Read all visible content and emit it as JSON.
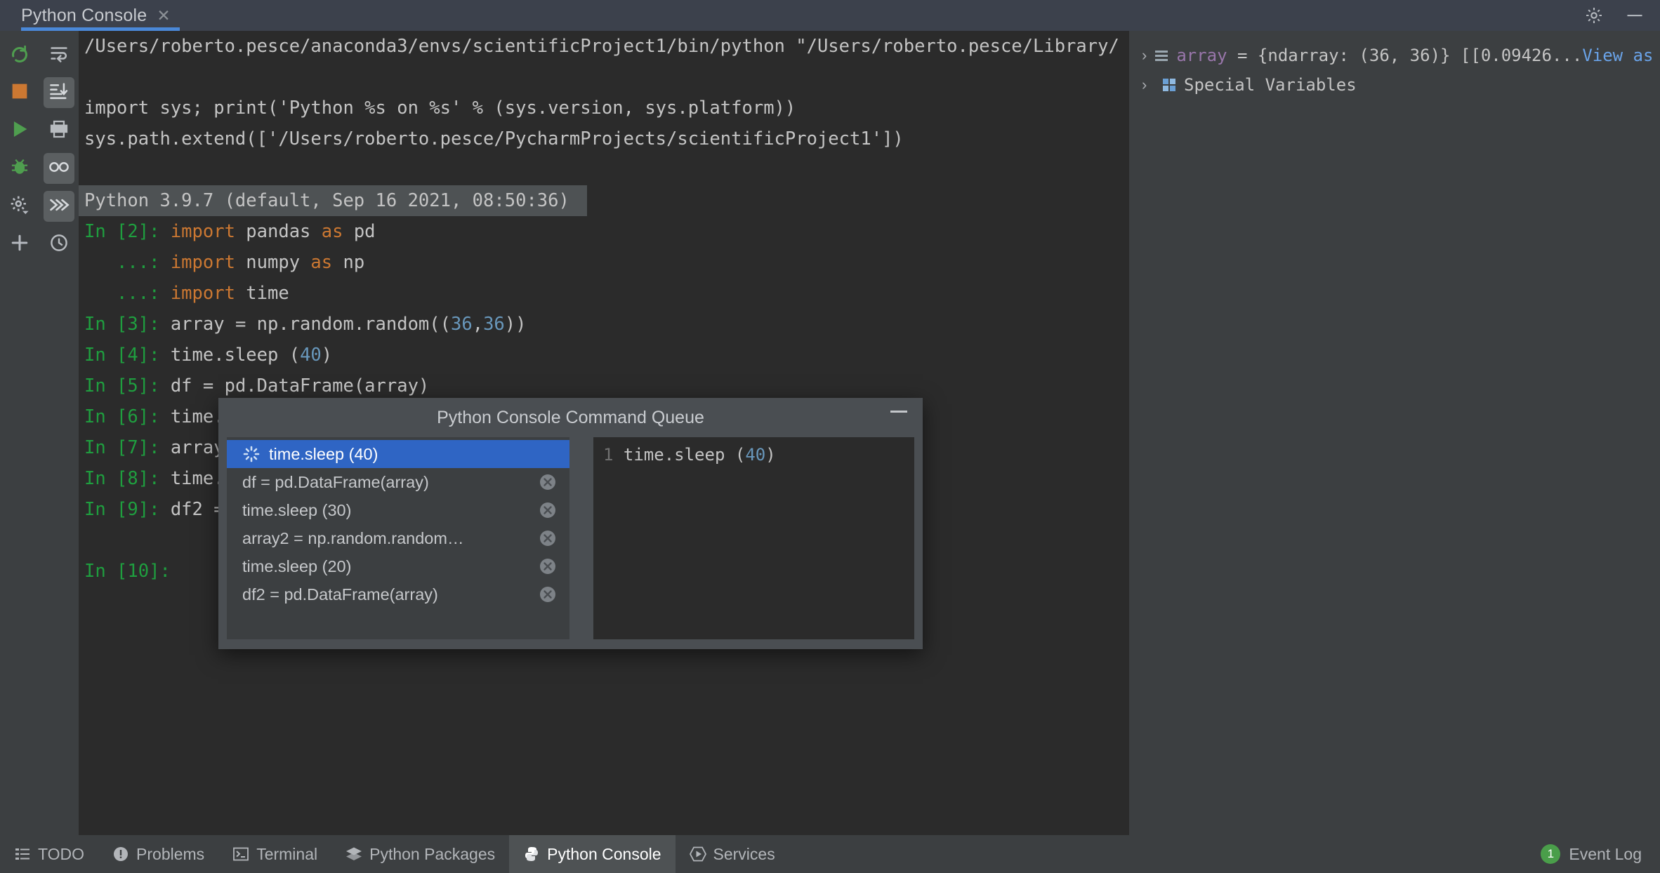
{
  "window": {
    "tab_label": "Python Console",
    "tab_close_icon": "close-icon",
    "settings_icon": "gear-icon",
    "minimize_icon": "minimize-icon"
  },
  "left_toolbar_primary": [
    {
      "name": "rerun-console-button",
      "icon": "rerun-icon"
    },
    {
      "name": "stop-button",
      "icon": "stop-square-icon"
    },
    {
      "name": "execute-button",
      "icon": "play-triangle-icon"
    },
    {
      "name": "debug-button",
      "icon": "bug-icon"
    },
    {
      "name": "settings-button",
      "icon": "gear-dropdown-icon"
    },
    {
      "name": "add-console-button",
      "icon": "plus-icon"
    }
  ],
  "left_toolbar_secondary": [
    {
      "name": "soft-wrap-button",
      "icon": "soft-wrap-icon",
      "active": false
    },
    {
      "name": "scroll-to-end-button",
      "icon": "scroll-to-end-icon",
      "active": true
    },
    {
      "name": "print-button",
      "icon": "printer-icon",
      "active": false
    },
    {
      "name": "show-variables-button",
      "icon": "glasses-icon",
      "active": true
    },
    {
      "name": "execute-multiline-button",
      "icon": "chevrons-right-icon",
      "active": true
    },
    {
      "name": "command-history-button",
      "icon": "clock-icon",
      "active": false
    }
  ],
  "console": {
    "lines": [
      {
        "type": "plain",
        "segments": [
          {
            "text": "/Users/roberto.pesce/anaconda3/envs/scientificProject1/bin/python \"/Users/roberto.pesce/Library/",
            "cls": "plain"
          }
        ]
      },
      {
        "type": "blank",
        "segments": []
      },
      {
        "type": "plain",
        "segments": [
          {
            "text": "import sys; print('Python %s on %s' % (sys.version, sys.platform))",
            "cls": "plain"
          }
        ]
      },
      {
        "type": "plain",
        "segments": [
          {
            "text": "sys.path.extend(['/Users/roberto.pesce/PycharmProjects/scientificProject1'])",
            "cls": "plain"
          }
        ]
      },
      {
        "type": "blank",
        "segments": []
      },
      {
        "type": "banner",
        "segments": [
          {
            "text": "Python 3.9.7 (default, Sep 16 2021, 08:50:36) ",
            "cls": "plain"
          }
        ]
      },
      {
        "type": "plain",
        "segments": [
          {
            "text": "In [2]: ",
            "cls": "prompt"
          },
          {
            "text": "import ",
            "cls": "kw"
          },
          {
            "text": "pandas ",
            "cls": "plain"
          },
          {
            "text": "as ",
            "cls": "kw"
          },
          {
            "text": "pd",
            "cls": "plain"
          }
        ]
      },
      {
        "type": "plain",
        "segments": [
          {
            "text": "   ...: ",
            "cls": "prompt"
          },
          {
            "text": "import ",
            "cls": "kw"
          },
          {
            "text": "numpy ",
            "cls": "plain"
          },
          {
            "text": "as ",
            "cls": "kw"
          },
          {
            "text": "np",
            "cls": "plain"
          }
        ]
      },
      {
        "type": "plain",
        "segments": [
          {
            "text": "   ...: ",
            "cls": "prompt"
          },
          {
            "text": "import ",
            "cls": "kw"
          },
          {
            "text": "time",
            "cls": "plain"
          }
        ]
      },
      {
        "type": "plain",
        "segments": [
          {
            "text": "In [3]: ",
            "cls": "prompt"
          },
          {
            "text": "array = np.random.random((",
            "cls": "plain"
          },
          {
            "text": "36",
            "cls": "num"
          },
          {
            "text": ",",
            "cls": "plain"
          },
          {
            "text": "36",
            "cls": "num"
          },
          {
            "text": "))",
            "cls": "plain"
          }
        ]
      },
      {
        "type": "plain",
        "segments": [
          {
            "text": "In [4]: ",
            "cls": "prompt"
          },
          {
            "text": "time.sleep (",
            "cls": "plain"
          },
          {
            "text": "40",
            "cls": "num"
          },
          {
            "text": ")",
            "cls": "plain"
          }
        ]
      },
      {
        "type": "plain",
        "segments": [
          {
            "text": "In [5]: ",
            "cls": "prompt"
          },
          {
            "text": "df = pd.DataFrame(array)",
            "cls": "plain"
          }
        ]
      },
      {
        "type": "plain",
        "segments": [
          {
            "text": "In [6]: ",
            "cls": "prompt"
          },
          {
            "text": "time.",
            "cls": "plain"
          }
        ]
      },
      {
        "type": "plain",
        "segments": [
          {
            "text": "In [7]: ",
            "cls": "prompt"
          },
          {
            "text": "array",
            "cls": "plain"
          }
        ]
      },
      {
        "type": "plain",
        "segments": [
          {
            "text": "In [8]: ",
            "cls": "prompt"
          },
          {
            "text": "time.",
            "cls": "plain"
          }
        ]
      },
      {
        "type": "plain",
        "segments": [
          {
            "text": "In [9]: ",
            "cls": "prompt"
          },
          {
            "text": "df2 =",
            "cls": "plain"
          }
        ]
      },
      {
        "type": "blank",
        "segments": []
      },
      {
        "type": "plain",
        "segments": [
          {
            "text": "In [10]: ",
            "cls": "prompt"
          }
        ]
      }
    ]
  },
  "variables_pane": {
    "rows": [
      {
        "name": "variable-row-array",
        "chevron": "chevron-right-icon",
        "icon": "ndarray-icon",
        "segments": [
          {
            "text": "array ",
            "cls": "vname"
          },
          {
            "text": "= {ndarray: (36, 36)} [[0.09426...",
            "cls": "plain"
          },
          {
            "text": "View as Array",
            "cls": "vlink"
          }
        ]
      },
      {
        "name": "variable-row-special-variables",
        "chevron": "chevron-right-icon",
        "icon": "special-variables-icon",
        "segments": [
          {
            "text": "Special Variables",
            "cls": "plain"
          }
        ]
      }
    ]
  },
  "dialog": {
    "title": "Python Console Command Queue",
    "minimize_icon": "minimize-icon",
    "queue_items": [
      {
        "label": "time.sleep (40)",
        "selected": true,
        "icon": "spinner-icon"
      },
      {
        "label": "df = pd.DataFrame(array)",
        "selected": false,
        "icon": "remove-circle-icon"
      },
      {
        "label": "time.sleep (30)",
        "selected": false,
        "icon": "remove-circle-icon"
      },
      {
        "label": "array2 = np.random.random…",
        "selected": false,
        "icon": "remove-circle-icon"
      },
      {
        "label": "time.sleep (20)",
        "selected": false,
        "icon": "remove-circle-icon"
      },
      {
        "label": "df2 = pd.DataFrame(array)",
        "selected": false,
        "icon": "remove-circle-icon"
      }
    ],
    "preview": {
      "line_number": "1",
      "segments": [
        {
          "text": "time.sleep ",
          "cls": "plain"
        },
        {
          "text": "(",
          "cls": "plain"
        },
        {
          "text": "40",
          "cls": "num"
        },
        {
          "text": ")",
          "cls": "plain"
        }
      ]
    }
  },
  "status_bar": {
    "items": [
      {
        "label": "TODO",
        "icon": "todo-list-icon",
        "active": false
      },
      {
        "label": "Problems",
        "icon": "problems-icon",
        "active": false
      },
      {
        "label": "Terminal",
        "icon": "terminal-icon",
        "active": false
      },
      {
        "label": "Python Packages",
        "icon": "packages-icon",
        "active": false
      },
      {
        "label": "Python Console",
        "icon": "python-icon",
        "active": true
      },
      {
        "label": "Services",
        "icon": "services-icon",
        "active": false
      }
    ],
    "event_log": {
      "label": "Event Log",
      "count": "1"
    }
  }
}
